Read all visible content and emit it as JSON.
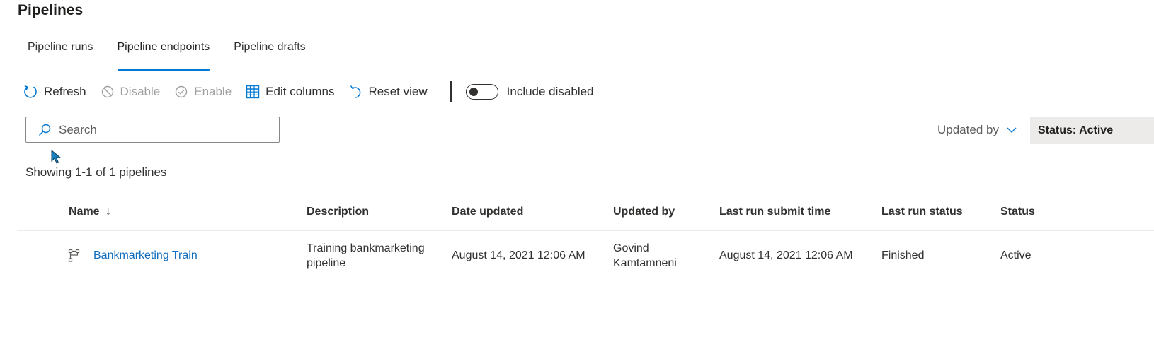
{
  "page": {
    "title": "Pipelines"
  },
  "tabs": [
    {
      "label": "Pipeline runs"
    },
    {
      "label": "Pipeline endpoints",
      "active": true
    },
    {
      "label": "Pipeline drafts"
    }
  ],
  "toolbar": {
    "refresh": "Refresh",
    "disable": "Disable",
    "enable": "Enable",
    "edit_columns": "Edit columns",
    "reset_view": "Reset view",
    "include_disabled": "Include disabled",
    "include_disabled_on": false
  },
  "search": {
    "placeholder": "Search",
    "value": ""
  },
  "filters": {
    "updated_by": "Updated by",
    "status": "Status: Active"
  },
  "results": {
    "count_text": "Showing 1-1 of 1 pipelines"
  },
  "table": {
    "columns": {
      "name": "Name",
      "description": "Description",
      "date_updated": "Date updated",
      "updated_by": "Updated by",
      "last_run_submit_time": "Last run submit time",
      "last_run_status": "Last run status",
      "status": "Status"
    },
    "sort_indicator": "↓",
    "rows": [
      {
        "name": "Bankmarketing Train",
        "description": "Training bankmarketing pipeline",
        "date_updated": "August 14, 2021 12:06 AM",
        "updated_by": "Govind Kamtamneni",
        "last_run_submit_time": "August 14, 2021 12:06 AM",
        "last_run_status": "Finished",
        "status": "Active"
      }
    ]
  },
  "colors": {
    "accent": "#0078d4",
    "link": "#0f6cbd",
    "disabled": "#a19f9d"
  },
  "icons": {
    "refresh": "refresh-icon",
    "disable": "block-icon",
    "enable": "check-circle-icon",
    "edit_columns": "table-grid-icon",
    "reset_view": "undo-icon",
    "search": "search-icon",
    "chevron": "chevron-down-icon",
    "pipeline": "pipeline-icon"
  }
}
